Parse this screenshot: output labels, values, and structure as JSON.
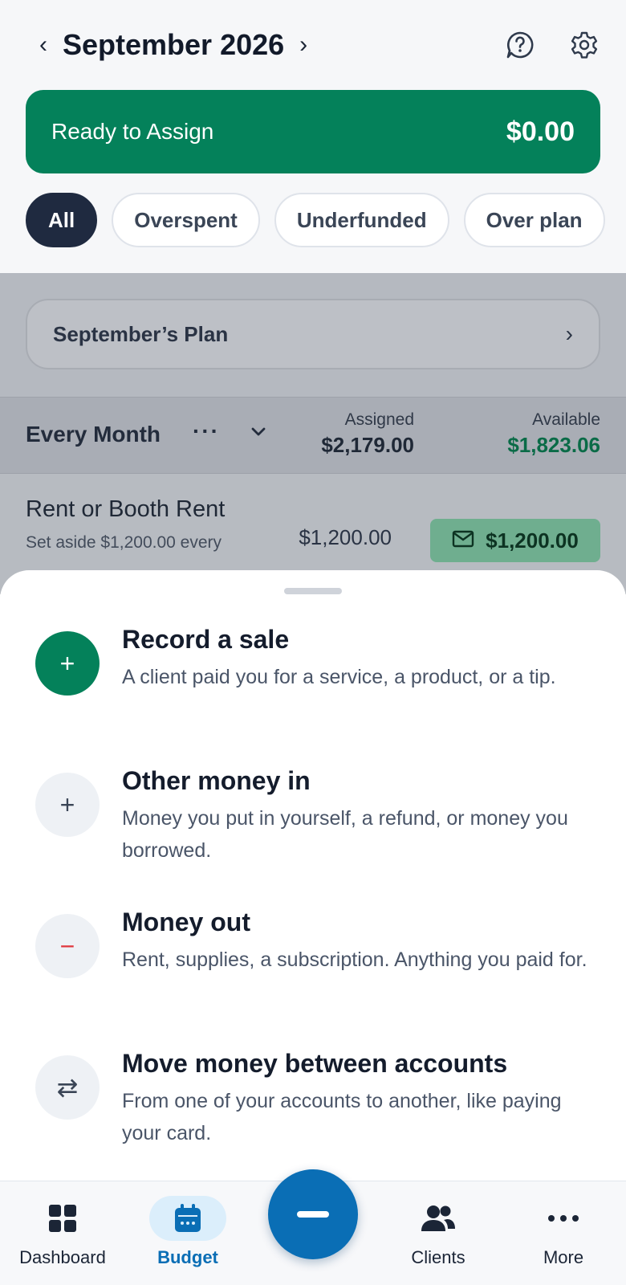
{
  "header": {
    "prev_arrow": "‹",
    "month": "September 2026",
    "next_arrow": "›",
    "help_icon": "help-chat-icon",
    "settings_icon": "gear-icon"
  },
  "ready": {
    "label": "Ready to Assign",
    "amount": "$0.00"
  },
  "filters": [
    {
      "label": "All",
      "active": true
    },
    {
      "label": "Overspent",
      "active": false
    },
    {
      "label": "Underfunded",
      "active": false
    },
    {
      "label": "Over plan",
      "active": false
    }
  ],
  "plan": {
    "label": "September’s Plan"
  },
  "group": {
    "name": "Every Month",
    "dots": "···",
    "assigned_label": "Assigned",
    "assigned_value": "$2,179.00",
    "available_label": "Available",
    "available_value": "$1,823.06"
  },
  "category": {
    "name": "Rent or Booth Rent",
    "sub": "Set aside $1,200.00 every",
    "assigned": "$1,200.00",
    "available": "$1,200.00"
  },
  "sheet": {
    "actions": [
      {
        "icon": "+",
        "title": "Record a sale",
        "desc": "A client paid you for a service, a product, or a tip."
      },
      {
        "icon": "+",
        "title": "Other money in",
        "desc": "Money you put in yourself, a refund, or money you borrowed."
      },
      {
        "icon": "−",
        "title": "Money out",
        "desc": "Rent, supplies, a subscription. Anything you paid for."
      },
      {
        "icon": "⇄",
        "title": "Move money between accounts",
        "desc": "From one of your accounts to another, like paying your card."
      }
    ]
  },
  "nav": {
    "dashboard": "Dashboard",
    "budget": "Budget",
    "clients": "Clients",
    "more": "More"
  },
  "colors": {
    "brand_green": "#04815a",
    "brand_blue": "#0a6eb5",
    "negative_red": "#e0383e"
  }
}
